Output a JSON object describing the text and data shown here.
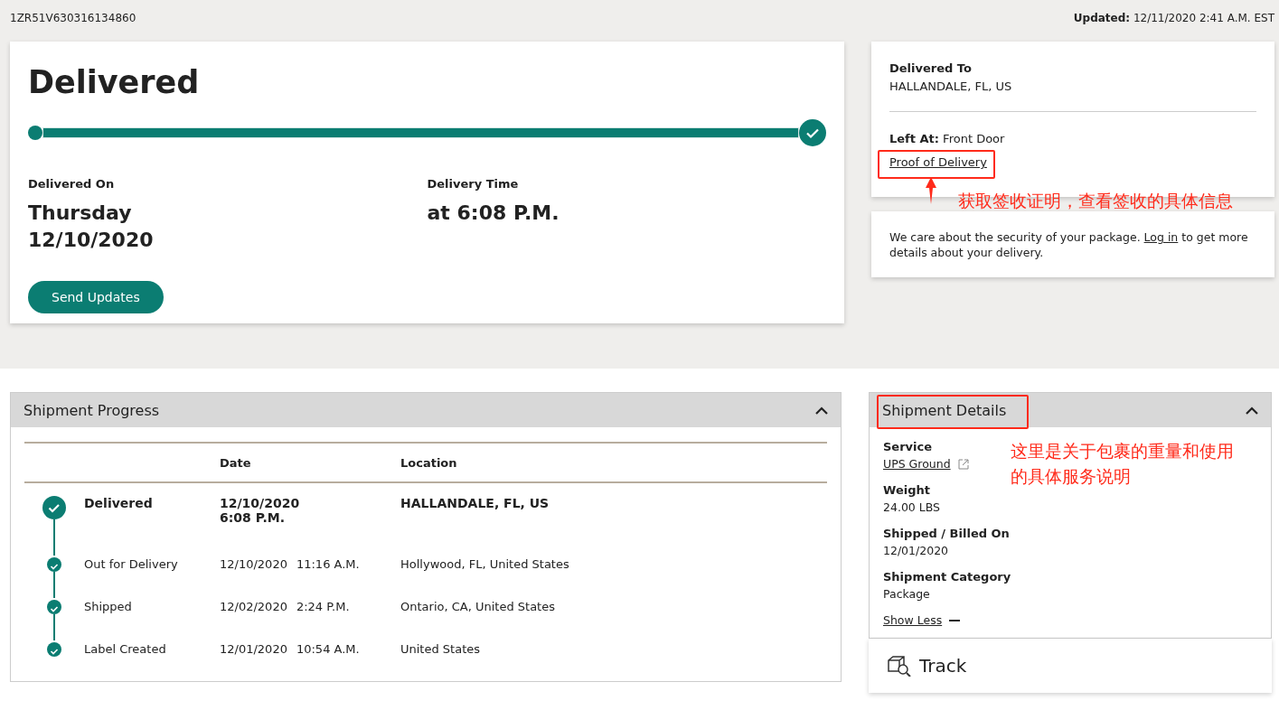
{
  "header": {
    "tracking_number": "1ZR51V630316134860",
    "updated_label": "Updated:",
    "updated_value": "12/11/2020 2:41 A.M. EST"
  },
  "status": {
    "title": "Delivered",
    "level": 1,
    "delivered_on_label": "Delivered On",
    "delivered_on_day": "Thursday",
    "delivered_on_date": "12/10/2020",
    "delivery_time_label": "Delivery Time",
    "delivery_time": "at 6:08 P.M.",
    "button": "Send Updates"
  },
  "destination": {
    "label": "Delivered To",
    "value": "HALLANDALE, FL, US",
    "left_at_label": "Left At:",
    "left_at_value": "Front Door",
    "proof_link": "Proof of Delivery"
  },
  "security_note": {
    "text_before": "We care about the security of your package.",
    "link": "Log in",
    "text_after": "to get more details about your delivery."
  },
  "progress": {
    "title": "Shipment Progress",
    "expanded": true,
    "columns": [
      "Date",
      "Location"
    ],
    "events": [
      {
        "kind": "major",
        "status": "Delivered",
        "date": "12/10/2020",
        "time": "6:08 P.M.",
        "location": "HALLANDALE, FL, US"
      },
      {
        "kind": "minor",
        "status": "Out for Delivery",
        "date": "12/10/2020",
        "time": "11:16 A.M.",
        "location": "Hollywood, FL, United States"
      },
      {
        "kind": "minor",
        "status": "Shipped",
        "date": "12/02/2020",
        "time": "2:24 P.M.",
        "location": "Ontario, CA, United States"
      },
      {
        "kind": "minor",
        "status": "Label Created",
        "date": "12/01/2020",
        "time": "10:54 A.M.",
        "location": "United States"
      }
    ]
  },
  "details": {
    "title": "Shipment Details",
    "expanded": true,
    "fields": [
      {
        "kind": "link",
        "label": "Service",
        "value": "UPS Ground"
      },
      {
        "kind": "text",
        "label": "Weight",
        "value": "24.00 LBS"
      },
      {
        "kind": "text",
        "label": "Shipped / Billed On",
        "value": "12/01/2020"
      },
      {
        "kind": "text",
        "label": "Shipment Category",
        "value": "Package"
      }
    ],
    "toggle": "Show Less"
  },
  "track": {
    "title": "Track"
  },
  "annotations": [
    {
      "text": "获取签收证明，查看签收的具体信息"
    },
    {
      "text": "这里是关于包裹的重量和使用的具体服务说明"
    }
  ]
}
